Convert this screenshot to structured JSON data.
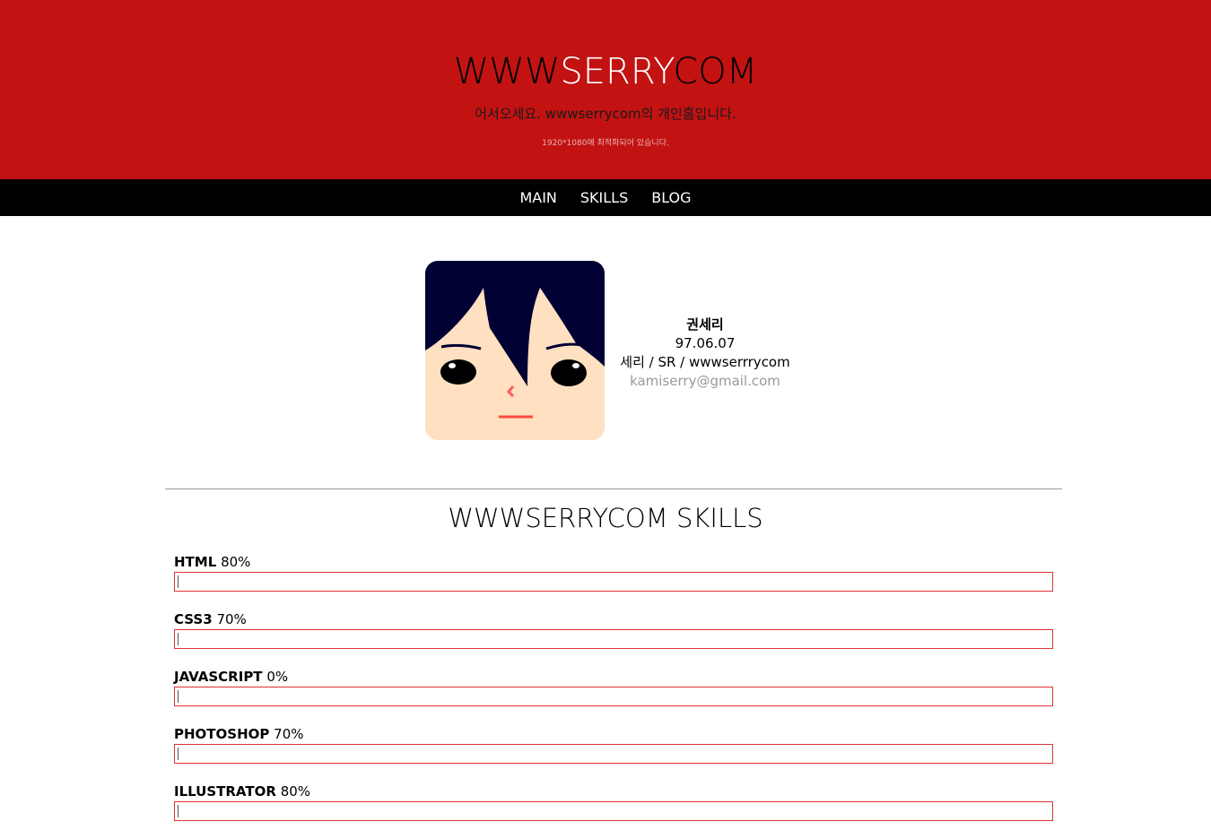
{
  "header": {
    "logo_part1": "WWW",
    "logo_part2": "SERRY",
    "logo_part3": "COM",
    "tagline": "어서오세요. wwwserrycom의 개인홈입니다.",
    "optimized": "1920*1080에 최적화되어 있습니다."
  },
  "nav": {
    "items": [
      "MAIN",
      "SKILLS",
      "BLOG"
    ]
  },
  "profile": {
    "name": "권세리",
    "birthdate": "97.06.07",
    "aliases": "세리 / SR / wwwserrrycom",
    "email": "kamiserry@gmail.com"
  },
  "skills": {
    "title": "WWWSERRYCOM SKILLS",
    "items": [
      {
        "name": "HTML",
        "percent": "80%",
        "fill": 0
      },
      {
        "name": "CSS3",
        "percent": "70%",
        "fill": 0
      },
      {
        "name": "JAVASCRIPT",
        "percent": "0%",
        "fill": 0
      },
      {
        "name": "PHOTOSHOP",
        "percent": "70%",
        "fill": 0
      },
      {
        "name": "ILLUSTRATOR",
        "percent": "80%",
        "fill": 0
      }
    ]
  },
  "colors": {
    "header_bg": "#c21212",
    "nav_bg": "#000000",
    "bar_border": "#dd3333"
  }
}
